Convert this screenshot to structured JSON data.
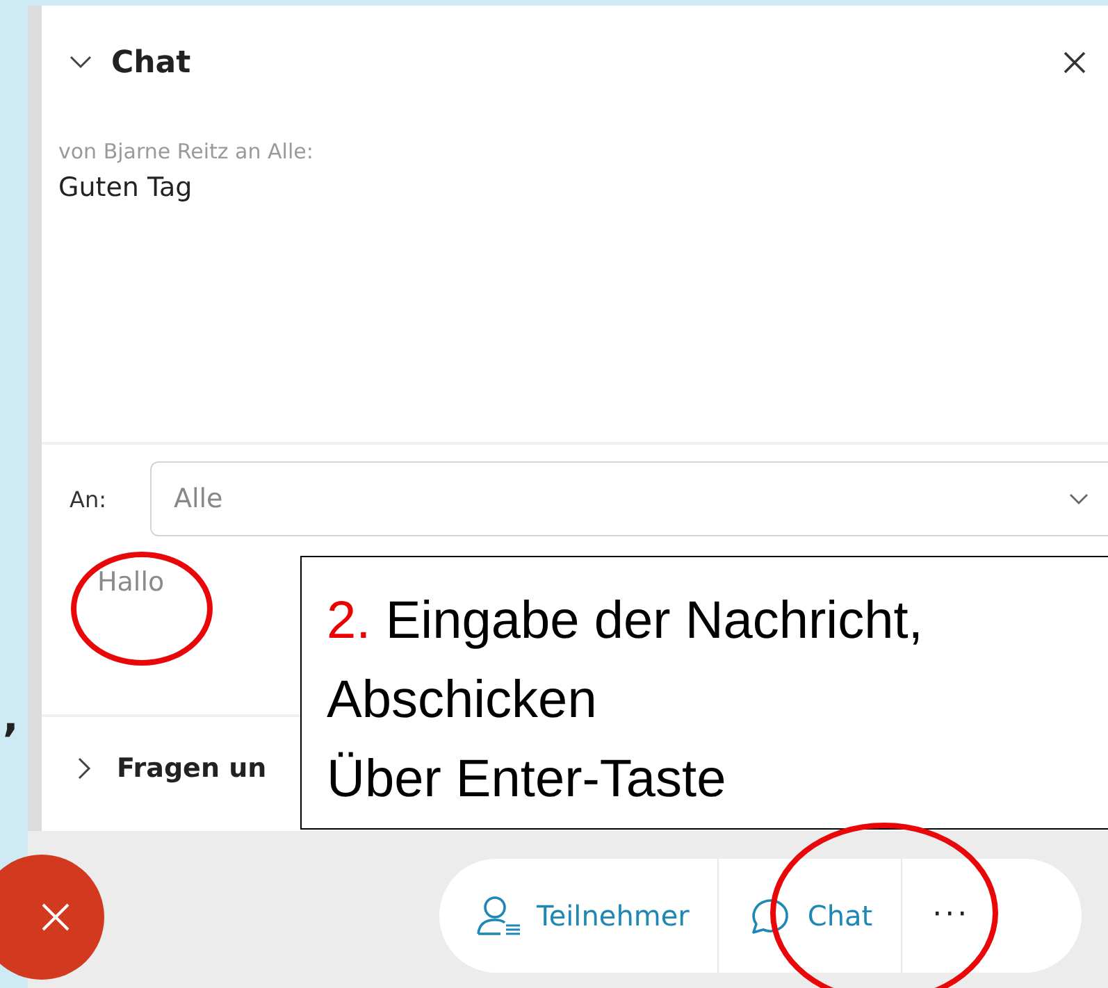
{
  "side_fragment": ",",
  "chat_panel": {
    "title": "Chat",
    "expanded": true,
    "messages": [
      {
        "sender": "von Bjarne Reitz an Alle:",
        "text": "Guten Tag"
      }
    ],
    "recipient": {
      "label": "An:",
      "value": "Alle"
    },
    "input": {
      "value": "Hallo"
    },
    "next_section": {
      "title": "Fragen un",
      "expanded": false
    }
  },
  "callout": {
    "number": "2.",
    "lines": [
      "Eingabe der Nachricht,",
      "Abschicken",
      "Über Enter-Taste"
    ]
  },
  "toolbar": {
    "buttons": [
      {
        "kind": "participants",
        "label": "Teilnehmer"
      },
      {
        "kind": "chat",
        "label": "Chat"
      },
      {
        "kind": "more",
        "label": "···"
      }
    ]
  }
}
